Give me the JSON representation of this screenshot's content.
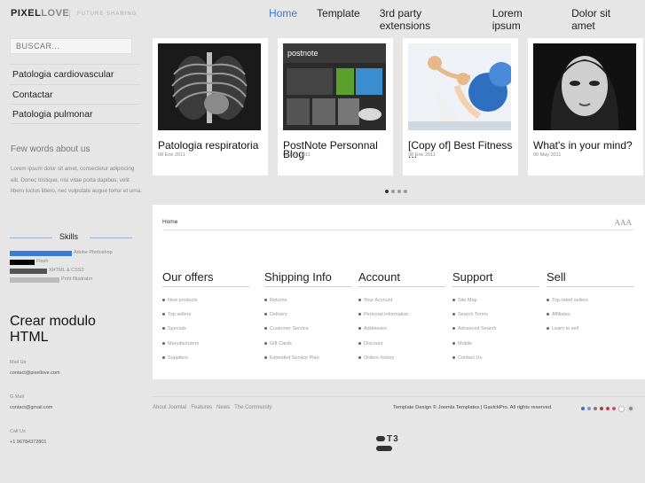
{
  "logo": {
    "part1": "PIXEL",
    "part2": "LOVE",
    "tagline": "FUTURE SHARING"
  },
  "nav": [
    {
      "label": "Home",
      "active": true
    },
    {
      "label": "Template",
      "active": false
    },
    {
      "label": "3rd party extensions",
      "active": false
    },
    {
      "label": "Lorem ipsum",
      "active": false
    },
    {
      "label": "Dolor sit amet",
      "active": false
    }
  ],
  "search": {
    "placeholder": "BUSCAR..."
  },
  "sidebar_menu": [
    "Patologia cardiovascular",
    "Contactar",
    "Patologia pulmonar"
  ],
  "about": {
    "title": "Few words about us",
    "text": "Lorem ipsum dolor sit amet, consectetur adipiscing elit. Donec tristique, nisi vitae porta dapibus, velit libero luctus libero, nec vulputate augue tortor et urna."
  },
  "skills": {
    "title": "Skills",
    "items": [
      {
        "label": "Adobe Photoshop",
        "level": 0.5,
        "color": "#3a7bd5"
      },
      {
        "label": "Flash",
        "level": 0.2,
        "color": "#000000"
      },
      {
        "label": "XHTML & CSS3",
        "level": 0.3,
        "color": "#555555"
      },
      {
        "label": "Print Illustrator",
        "level": 0.4,
        "color": "#bbbbbb"
      }
    ]
  },
  "module": {
    "title": "Crear modulo HTML",
    "contacts": [
      {
        "label": "Mail Us",
        "value": "contact@pixellove.com"
      },
      {
        "label": "G Mail",
        "value": "contact@gmail.com"
      },
      {
        "label": "Call Us",
        "value": "+1 96784372801"
      }
    ]
  },
  "slides": [
    {
      "title": "Patologia respiratoria",
      "date": "08 Ene 2011",
      "image": "chest-xray"
    },
    {
      "title": "PostNote Personnal Blog",
      "date": "08 Ene 2011",
      "image": "postnote-screenshot"
    },
    {
      "title": "[Copy of] Best Fitness ...",
      "date": "08 Ene 2011",
      "image": "fitness-photo"
    },
    {
      "title": "What's in your mind?",
      "date": "06 May 2011",
      "image": "portrait-photo"
    }
  ],
  "breadcrumb": "Home",
  "font_resizer": "AAA",
  "footer_columns": [
    {
      "title": "Our offers",
      "links": [
        "New products",
        "Top sellers",
        "Specials",
        "Manufacturers",
        "Suppliers"
      ]
    },
    {
      "title": "Shipping Info",
      "links": [
        "Returns",
        "Delivery",
        "Customer Service",
        "Gift Cards",
        "Extended Service Plan"
      ]
    },
    {
      "title": "Account",
      "links": [
        "Your Account",
        "Personal information",
        "Addresses",
        "Discount",
        "Orders history"
      ]
    },
    {
      "title": "Support",
      "links": [
        "Site Map",
        "Search Terms",
        "Advanced Search",
        "Mobile",
        "Contact Us"
      ]
    },
    {
      "title": "Sell",
      "links": [
        "Top-rated sellers",
        "Affiliates",
        "Learn to sell"
      ]
    }
  ],
  "footer_links": [
    "About Joomla!",
    "Features",
    "News",
    "The Community"
  ],
  "credit": "Template Design © Joomla Templates | GavickPro. All rights reserved.",
  "theme_colors": [
    "#4a6fb0",
    "#8c8cc8",
    "#7a7a7a",
    "#a04040",
    "#c04040",
    "#d05050",
    "#ffffff"
  ],
  "t3_logo": "T3"
}
